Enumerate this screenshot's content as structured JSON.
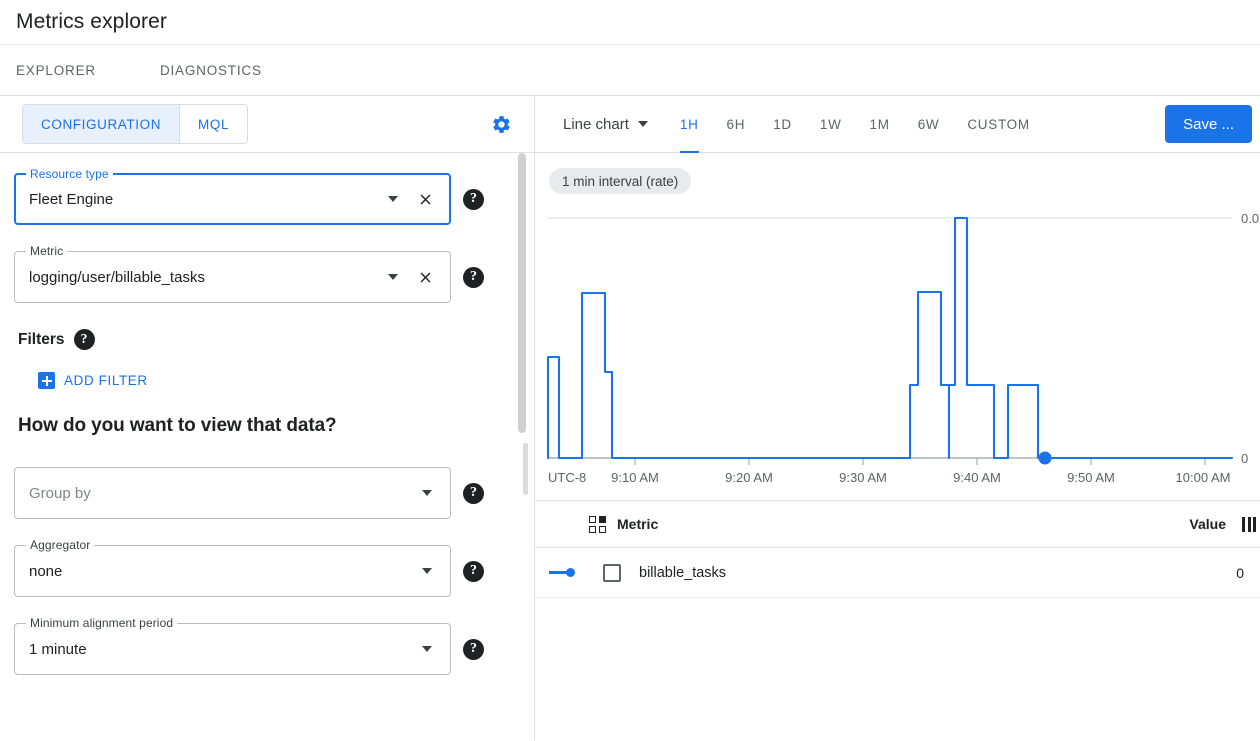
{
  "header": {
    "title": "Metrics explorer"
  },
  "top_tabs": [
    {
      "label": "EXPLORER"
    },
    {
      "label": "DIAGNOSTICS"
    }
  ],
  "config_panel": {
    "tabs": [
      {
        "label": "CONFIGURATION",
        "active": true
      },
      {
        "label": "MQL",
        "active": false
      }
    ],
    "settings_icon": "gear-icon",
    "fields": [
      {
        "label": "Resource type",
        "value": "Fleet Engine",
        "focused": true,
        "has_clear": true,
        "has_help": true
      },
      {
        "label": "Metric",
        "value": "logging/user/billable_tasks",
        "focused": false,
        "has_clear": true,
        "has_help": true
      }
    ],
    "filters": {
      "title": "Filters",
      "add_filter_label": "ADD FILTER",
      "add_filter_icon": "plus-square-icon",
      "help_icon": "help-icon"
    },
    "view_section": {
      "question": "How do you want to view that data?",
      "fields": [
        {
          "label": "",
          "placeholder": "Group by",
          "value": "",
          "is_placeholder": true
        },
        {
          "label": "Aggregator",
          "value": "none",
          "is_placeholder": false
        },
        {
          "label": "Minimum alignment period",
          "value": "1 minute",
          "is_placeholder": false
        }
      ]
    }
  },
  "chart_toolbar": {
    "chart_type": "Line chart",
    "chart_type_caret": "chevron-down-icon",
    "ranges": [
      {
        "label": "1H",
        "active": true
      },
      {
        "label": "6H",
        "active": false
      },
      {
        "label": "1D",
        "active": false
      },
      {
        "label": "1W",
        "active": false
      },
      {
        "label": "1M",
        "active": false
      },
      {
        "label": "6W",
        "active": false
      },
      {
        "label": "CUSTOM",
        "active": false
      }
    ],
    "save_label": "Save ...",
    "interval_chip": "1 min interval (rate)"
  },
  "chart_data": {
    "type": "line",
    "title": "",
    "subtitle": "1 min interval (rate)",
    "xlabel": "",
    "ylabel": "",
    "timezone_label": "UTC-8",
    "x_tick_labels": [
      "UTC-8",
      "9:10 AM",
      "9:20 AM",
      "9:30 AM",
      "9:40 AM",
      "9:50 AM",
      "10:00 AM"
    ],
    "y_tick_labels": [
      "0.0",
      "0"
    ],
    "ylim": [
      0,
      1
    ],
    "grid": true,
    "legend_position": "below-table",
    "line_color": "#1a73e8",
    "end_marker": {
      "x": "9:45 AM",
      "y": 0,
      "color": "#1a73e8"
    },
    "step_interpolation": true,
    "series": [
      {
        "name": "billable_tasks",
        "color": "#1a73e8",
        "x": [
          "9:02",
          "9:03",
          "9:04",
          "9:05",
          "9:06",
          "9:07",
          "9:08",
          "9:09",
          "9:10",
          "9:11",
          "9:30",
          "9:31",
          "9:32",
          "9:33",
          "9:34",
          "9:35",
          "9:36",
          "9:37",
          "9:38",
          "9:39",
          "9:40",
          "9:41",
          "9:42",
          "9:43",
          "9:44",
          "9:45"
        ],
        "values": [
          0,
          0.42,
          0.42,
          0,
          0.78,
          0.78,
          0.52,
          0,
          0,
          0,
          0,
          0.42,
          0.42,
          0.72,
          0.72,
          0.42,
          1.0,
          1.0,
          0.42,
          0.42,
          0,
          0,
          0.42,
          0.42,
          0,
          0
        ]
      }
    ]
  },
  "legend_table": {
    "select_all_icon": "grid-select-icon",
    "columns_icon": "column-settings-icon",
    "headers": {
      "metric": "Metric",
      "value": "Value"
    },
    "rows": [
      {
        "name": "billable_tasks",
        "value": "0",
        "checked": false,
        "color": "#1a73e8"
      }
    ]
  }
}
